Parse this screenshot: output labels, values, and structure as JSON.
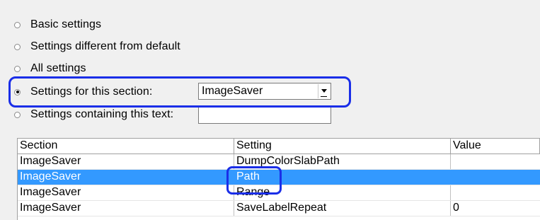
{
  "options": [
    {
      "label": "Basic settings",
      "checked": false
    },
    {
      "label": "Settings different from default",
      "checked": false
    },
    {
      "label": "All settings",
      "checked": false
    },
    {
      "label": "Settings for this section:",
      "checked": true
    },
    {
      "label": "Settings containing this text:",
      "checked": false
    }
  ],
  "section_select": {
    "value": "ImageSaver"
  },
  "text_filter": {
    "value": ""
  },
  "table": {
    "columns": [
      "Section",
      "Setting",
      "Value"
    ],
    "rows": [
      {
        "section": "ImageSaver",
        "setting": "DumpColorSlabPath",
        "value": ""
      },
      {
        "section": "ImageSaver",
        "setting": "Path",
        "value": ""
      },
      {
        "section": "ImageSaver",
        "setting": "Range",
        "value": ""
      },
      {
        "section": "ImageSaver",
        "setting": "SaveLabelRepeat",
        "value": "0"
      }
    ],
    "selected_row": 1
  },
  "colors": {
    "highlight_border": "#1a2ee8",
    "selection": "#3399ff"
  }
}
